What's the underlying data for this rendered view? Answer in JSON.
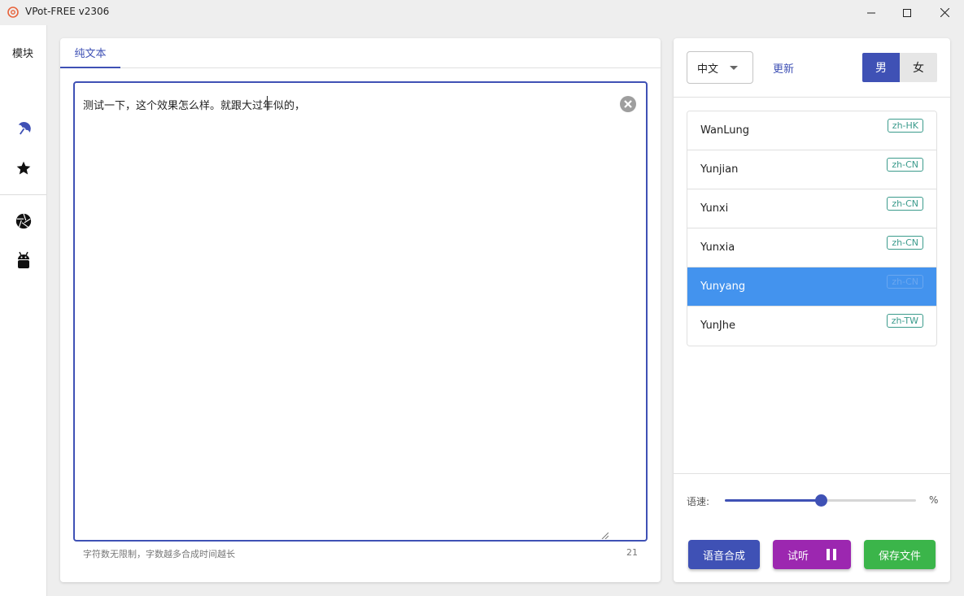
{
  "window": {
    "title": "VPot-FREE v2306"
  },
  "sidebar": {
    "title": "模块",
    "items": [
      {
        "icon": "umbrella-icon"
      },
      {
        "icon": "star-icon"
      },
      {
        "icon": "aperture-icon"
      },
      {
        "icon": "android-icon"
      }
    ]
  },
  "editor": {
    "tab_label": "纯文本",
    "text": "测试一下，这个效果怎么样。就跟大过年似的，",
    "hint": "字符数无限制，字数越多合成时间越长",
    "char_count": "21"
  },
  "voice_panel": {
    "language": "中文",
    "update_label": "更新",
    "gender_male": "男",
    "gender_female": "女",
    "selected_gender": "男",
    "voices": [
      {
        "name": "WanLung",
        "locale": "zh-HK",
        "selected": false
      },
      {
        "name": "Yunjian",
        "locale": "zh-CN",
        "selected": false
      },
      {
        "name": "Yunxi",
        "locale": "zh-CN",
        "selected": false
      },
      {
        "name": "Yunxia",
        "locale": "zh-CN",
        "selected": false
      },
      {
        "name": "Yunyang",
        "locale": "zh-CN",
        "selected": true
      },
      {
        "name": "YunJhe",
        "locale": "zh-TW",
        "selected": false
      }
    ],
    "speed_label": "语速:",
    "speed_value": 0.5,
    "speed_unit": "%"
  },
  "actions": {
    "synthesize": "语音合成",
    "listen": "试听",
    "save": "保存文件"
  },
  "colors": {
    "primary": "#3f51b5",
    "selected_row": "#4393ee",
    "listen_button": "#9c27b0",
    "save_button": "#3bb54a",
    "tag": "#3b9b8c"
  }
}
